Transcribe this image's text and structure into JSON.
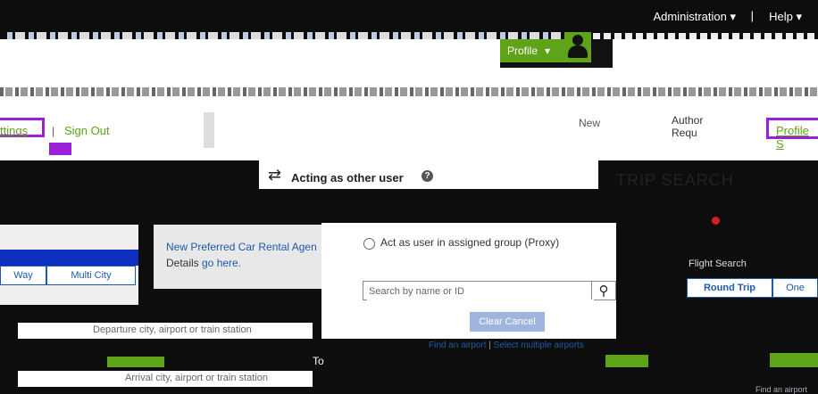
{
  "header": {
    "administration_label": "Administration ▾",
    "separator": "|",
    "help_label": "Help ▾"
  },
  "profile_menu": {
    "label": "Profile",
    "chevron": "▾",
    "icon": "user-avatar-icon"
  },
  "user_links": {
    "settings_label": "ttings",
    "separator": "|",
    "signout_label": "Sign Out"
  },
  "request_area": {
    "new_label": "New",
    "author_label": "Author",
    "req_label": "Requ",
    "profile_link": "Profile S"
  },
  "acting": {
    "title": "Acting as other user",
    "icon": "shuffle-icon",
    "help_icon": "?"
  },
  "trip_search_title": "TRIP SEARCH",
  "promo": {
    "line1": "New Preferred Car Rental Agen",
    "line2_prefix": "Details ",
    "line2_link": "go here."
  },
  "proxy": {
    "option_label": "Act as user in assigned group (Proxy)",
    "search_placeholder": "Search by name or ID",
    "clear_label": "Clear Cancel"
  },
  "left_tabs": {
    "oneway": "Way",
    "multi": "Multi City"
  },
  "right_tabs": {
    "roundtrip": "Round Trip",
    "oneway": "One",
    "flight_search": "Flight Search"
  },
  "fields": {
    "departure_placeholder": "Departure city, airport or train station",
    "arrival_placeholder": "Arrival city, airport or train station",
    "to_label": "To"
  },
  "links": {
    "find_airport": "Find an airport",
    "separator": "|",
    "select_multiple": "Select multiple airports",
    "find_airport_right": "Find an airport"
  },
  "colors": {
    "accent_green": "#5fa319",
    "highlight_purple": "#9b1fd6",
    "link_blue": "#1e5aa8"
  }
}
